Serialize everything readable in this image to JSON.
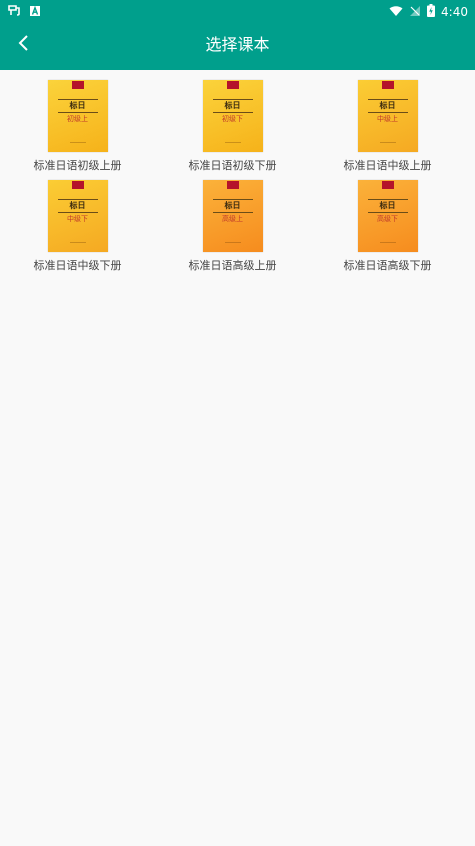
{
  "status_bar": {
    "time": "4:40"
  },
  "app_bar": {
    "title": "选择课本"
  },
  "books": [
    {
      "label": "标准日语初级上册",
      "cover_title": "标日",
      "cover_subtitle": "初级上",
      "cover_color_top": "#fbd33b",
      "cover_color_bottom": "#f6b21a"
    },
    {
      "label": "标准日语初级下册",
      "cover_title": "标日",
      "cover_subtitle": "初级下",
      "cover_color_top": "#fbd33b",
      "cover_color_bottom": "#f6b21a"
    },
    {
      "label": "标准日语中级上册",
      "cover_title": "标日",
      "cover_subtitle": "中级上",
      "cover_color_top": "#fbcd34",
      "cover_color_bottom": "#f5a922"
    },
    {
      "label": "标准日语中级下册",
      "cover_title": "标日",
      "cover_subtitle": "中级下",
      "cover_color_top": "#fbcd34",
      "cover_color_bottom": "#f5a922"
    },
    {
      "label": "标准日语高级上册",
      "cover_title": "标日",
      "cover_subtitle": "高级上",
      "cover_color_top": "#fbb23a",
      "cover_color_bottom": "#f68c1e"
    },
    {
      "label": "标准日语高级下册",
      "cover_title": "标日",
      "cover_subtitle": "高级下",
      "cover_color_top": "#fbb23a",
      "cover_color_bottom": "#f68c1e"
    }
  ],
  "colors": {
    "primary": "#009f8c",
    "background": "#f9f9f9"
  }
}
